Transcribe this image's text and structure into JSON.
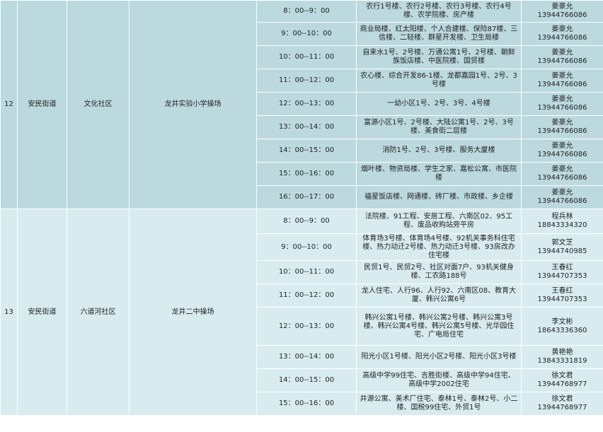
{
  "groups": [
    {
      "no": "12",
      "street": "安民街道",
      "community": "文化社区",
      "site": "龙井实验小学操场",
      "rows": [
        {
          "time": "8：00--9：00",
          "buildings": "农行1号楼、农行2号楼、农行3号楼、农行4号楼、农学院楼、房产楼",
          "name": "姜豪允",
          "phone": "13944766086"
        },
        {
          "time": "9：00--10：00",
          "buildings": "商业局楼、红太阳楼、个人合建楼、保险87楼、三信楼、二轻楼、群星开发楼、卫生局楼",
          "name": "姜豪允",
          "phone": "13944766086"
        },
        {
          "time": "10：00--11：00",
          "buildings": "自来水1号、2号楼、万通公寓1号、2号楼、朝鲜族饭店楼、中医院楼、国贸楼",
          "name": "姜豪允",
          "phone": "13944766086"
        },
        {
          "time": "11：00--12：00",
          "buildings": "农心楼、综合开发86-1楼、龙都嘉园1号、2号、3号楼",
          "name": "姜豪允",
          "phone": "13944766086"
        },
        {
          "time": "12：00--13：00",
          "buildings": "一幼小区1号、2号、3号、4号楼",
          "name": "姜豪允",
          "phone": "13944766086"
        },
        {
          "time": "13：00--14：00",
          "buildings": "富源小区1号、2号楼、大陆公寓1号、2号、3号楼、美食街二层楼",
          "name": "姜豪允",
          "phone": "13944766086"
        },
        {
          "time": "14：00--15：00",
          "buildings": "消防1号、2号、3号楼、服务大厦楼",
          "name": "姜豪允",
          "phone": "13944766086"
        },
        {
          "time": "15：00--16：00",
          "buildings": "烟叶楼、物资局楼、学生之家、嘉松公寓、市医院楼",
          "name": "姜豪允",
          "phone": "13944766086"
        },
        {
          "time": "16：00--17：00",
          "buildings": "福星饭店楼、网通楼、砖厂楼、市政楼、乡企楼",
          "name": "姜豪允",
          "phone": "13944766086"
        }
      ]
    },
    {
      "no": "13",
      "street": "安民街道",
      "community": "六道河社区",
      "site": "龙井二中操场",
      "rows": [
        {
          "time": "8：00--9：00",
          "buildings": "法院楼、91工程、安居工程、六南区02、95工程、废品收购站旁平房",
          "name": "程兵林",
          "phone": "18843334320"
        },
        {
          "time": "9：00--10：00",
          "buildings": "体育场3号楼、体育场4号楼、92机关事务科住宅楼、热力动迁2号楼、热力动迁3号楼、93房改办住宅楼",
          "name": "郭文芝",
          "phone": "13944740985"
        },
        {
          "time": "10：00--11：00",
          "buildings": "民贸1号、民贸2号、社区对面7户、93机关健身楼、工农路188号",
          "name": "王春红",
          "phone": "13944707353"
        },
        {
          "time": "11：00--12：00",
          "buildings": "龙人住宅、人行96、人行92、六南区08、教育大厦、韩兴公寓6号",
          "name": "王春红",
          "phone": "13944707353"
        },
        {
          "time": "12：00--13：00",
          "buildings": "韩兴公寓1号楼、韩兴公寓2号楼、韩兴公寓3号楼、韩兴公寓4号楼、韩兴公寓5号楼、光华园住宅、广电局住宅",
          "name": "李文彬",
          "phone": "18643336360"
        },
        {
          "time": "13：00--14：00",
          "buildings": "阳光小区1号楼、阳光小区2号楼、阳光小区3号楼",
          "name": "黄艳艳",
          "phone": "13843331819"
        },
        {
          "time": "14：00--15：00",
          "buildings": "高级中学99住宅、吉胜街楼、高级中学94住宅、高级中学2002住宅",
          "name": "徐文君",
          "phone": "13944768977"
        },
        {
          "time": "15：00--16：00",
          "buildings": "井源公寓、美术厂住宅、泰林1号、泰林2号、小二楼、国税99住宅、外贸1号",
          "name": "徐文君",
          "phone": "13944768977"
        }
      ]
    }
  ]
}
